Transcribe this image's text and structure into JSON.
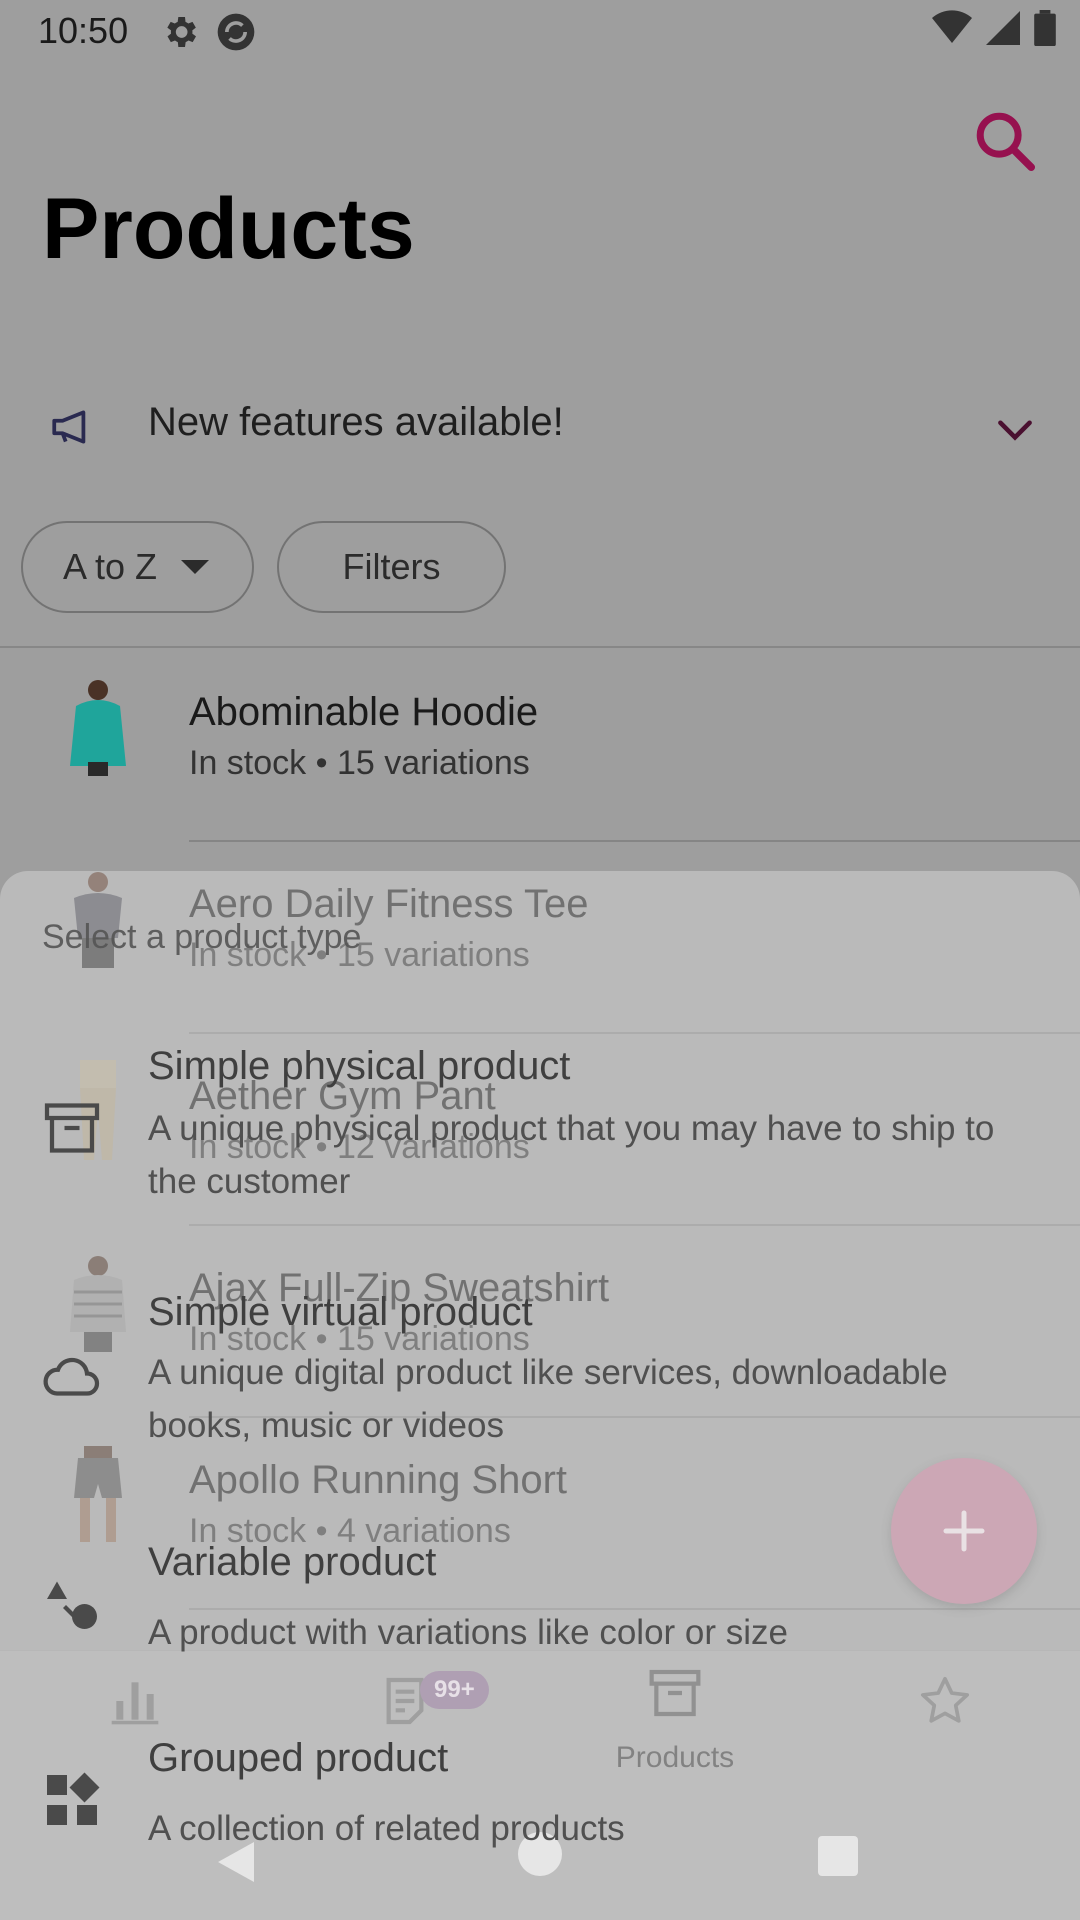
{
  "status_bar": {
    "time": "10:50"
  },
  "header": {
    "title": "Products"
  },
  "banner": {
    "text": "New features available!"
  },
  "chips": {
    "sort_label": "A to Z",
    "filters_label": "Filters"
  },
  "products": [
    {
      "name": "Abominable Hoodie",
      "meta": "In stock • 15 variations"
    },
    {
      "name": "Aero Daily Fitness Tee",
      "meta": "In stock • 15 variations"
    },
    {
      "name": "Aether Gym Pant",
      "meta": "In stock • 12 variations"
    },
    {
      "name": "Ajax Full-Zip Sweatshirt",
      "meta": "In stock • 15 variations"
    },
    {
      "name": "Apollo Running Short",
      "meta": "In stock • 4 variations"
    }
  ],
  "bottom_nav": {
    "orders_badge": "99+",
    "products_label": "Products"
  },
  "sheet": {
    "title": "Select a product type",
    "options": [
      {
        "title": "Simple physical product",
        "description": "A unique physical product that you may have to ship to the customer",
        "icon": "archive-box-icon"
      },
      {
        "title": "Simple virtual product",
        "description": "A unique digital product like services, downloadable books, music or videos",
        "icon": "cloud-icon"
      },
      {
        "title": "Variable product",
        "description": "A product with variations like color or size",
        "icon": "shapes-icon"
      },
      {
        "title": "Grouped product",
        "description": "A collection of related products",
        "icon": "widgets-icon"
      }
    ]
  },
  "colors": {
    "accent": "#96114f",
    "fab": "#c07c95",
    "badge": "#8b6e93"
  }
}
